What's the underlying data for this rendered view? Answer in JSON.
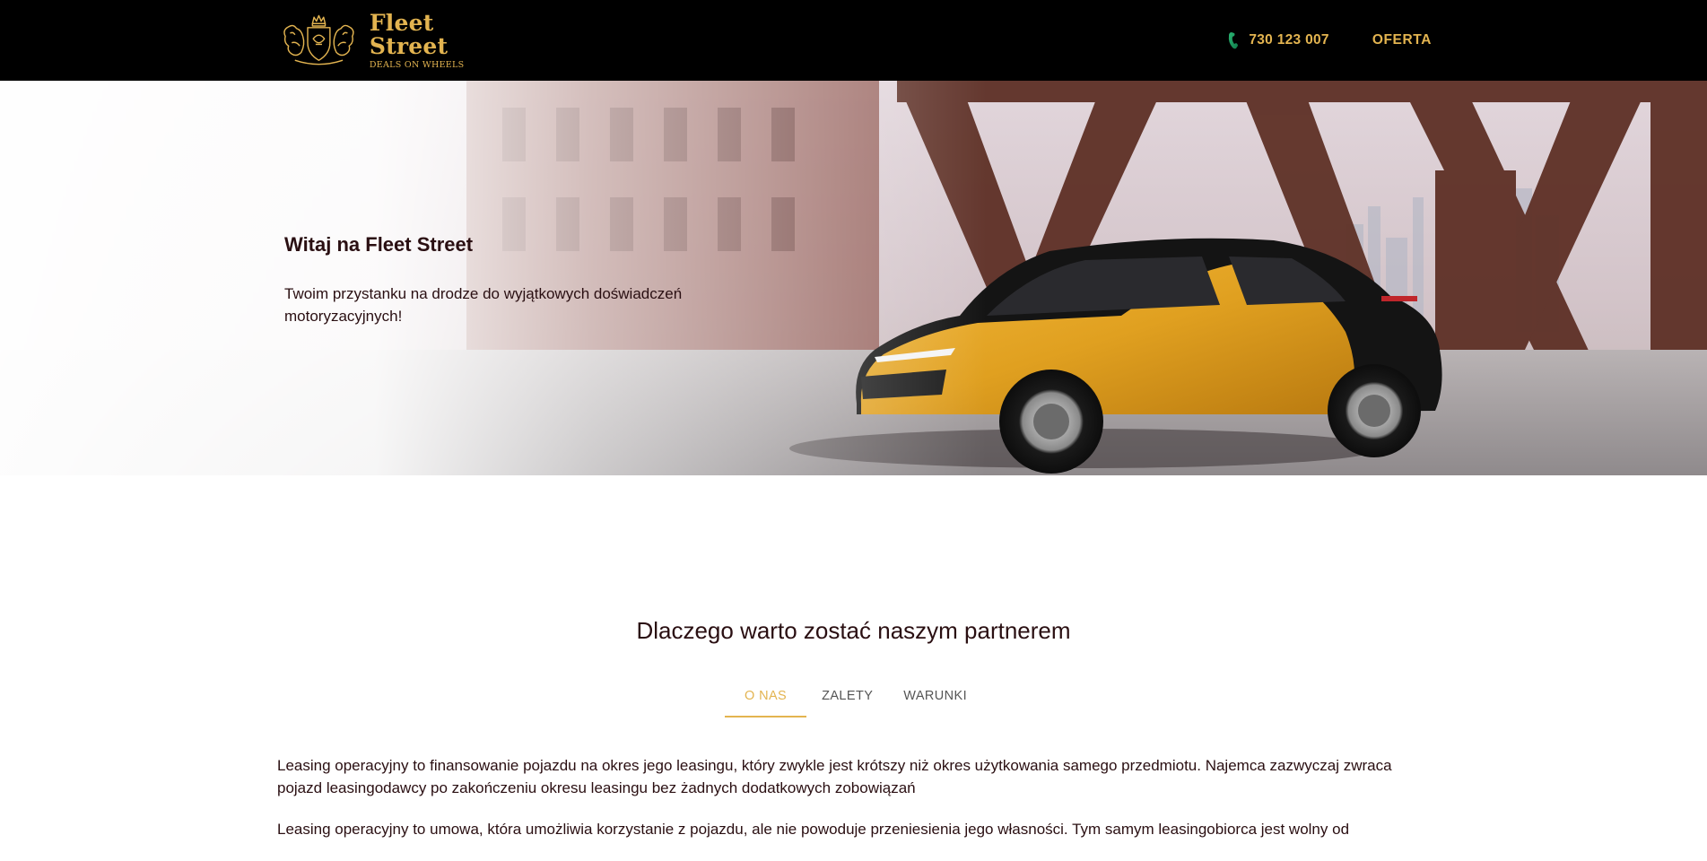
{
  "header": {
    "logo": {
      "name": "Fleet Street",
      "tagline": "DEALS ON WHEELS",
      "emblem_icon": "crest-with-lions-icon"
    },
    "phone": {
      "icon": "phone-icon",
      "number": "730 123 007"
    },
    "nav": {
      "offer_label": "OFERTA"
    }
  },
  "hero": {
    "title": "Witaj na Fleet Street",
    "subtitle": "Twoim przystanku na drodze do wyjątkowych doświadczeń motoryzacyjnych!",
    "image": "yellow-black-suv-under-steel-bridge"
  },
  "partner_section": {
    "title": "Dlaczego warto zostać naszym partnerem",
    "tabs": [
      {
        "label": "O NAS",
        "active": true
      },
      {
        "label": "ZALETY",
        "active": false
      },
      {
        "label": "WARUNKI",
        "active": false
      }
    ],
    "paragraphs": [
      "Leasing operacyjny to finansowanie pojazdu na okres jego leasingu, który zwykle jest krótszy niż okres użytkowania samego przedmiotu. Najemca zazwyczaj zwraca pojazd leasingodawcy po zakończeniu okresu leasingu bez żadnych dodatkowych zobowiązań",
      "Leasing operacyjny to umowa, która umożliwia korzystanie z pojazdu, ale nie powoduje przeniesienia jego własności. Tym samym leasingobiorca jest wolny od"
    ]
  },
  "colors": {
    "accent_gold": "#e3b450",
    "header_bg": "#000000",
    "text_dark": "#2a0f12"
  }
}
